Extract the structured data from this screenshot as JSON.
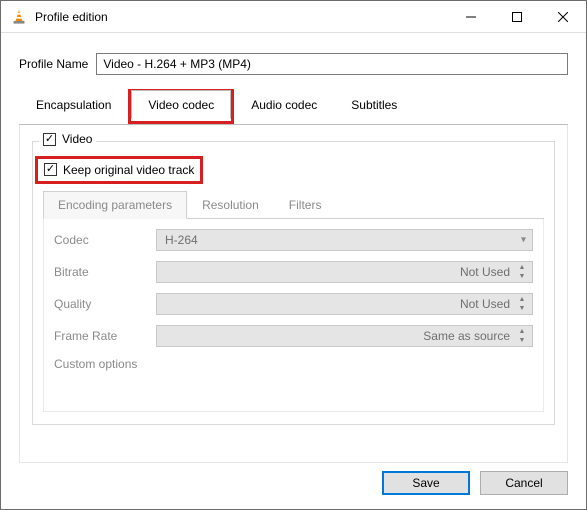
{
  "window": {
    "title": "Profile edition"
  },
  "profile": {
    "label": "Profile Name",
    "value": "Video - H.264 + MP3 (MP4)"
  },
  "tabs": {
    "encapsulation": "Encapsulation",
    "video": "Video codec",
    "audio": "Audio codec",
    "subtitles": "Subtitles"
  },
  "video_section": {
    "legend": "Video",
    "keep_original": "Keep original video track"
  },
  "subtabs": {
    "encoding": "Encoding parameters",
    "resolution": "Resolution",
    "filters": "Filters"
  },
  "fields": {
    "codec": {
      "label": "Codec",
      "value": "H-264"
    },
    "bitrate": {
      "label": "Bitrate",
      "value": "Not Used"
    },
    "quality": {
      "label": "Quality",
      "value": "Not Used"
    },
    "framerate": {
      "label": "Frame Rate",
      "value": "Same as source"
    },
    "custom": {
      "label": "Custom options"
    }
  },
  "buttons": {
    "save": "Save",
    "cancel": "Cancel"
  }
}
